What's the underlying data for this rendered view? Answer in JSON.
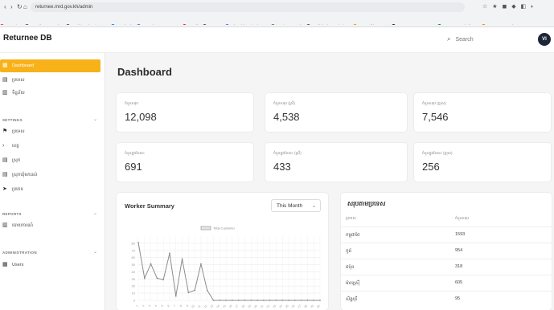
{
  "browser": {
    "url": "returnee.mrd.gov.kh/admin",
    "nav_glyphs": [
      "‹",
      "›",
      "↻",
      "⌂"
    ],
    "ext_icons": "☆ ★ ◼ ◆ ◧ ◐",
    "bookmarks": [
      {
        "label": "YouTube",
        "color": "#e53935"
      },
      {
        "label": "Contributor Portal -",
        "color": "#555555"
      },
      {
        "label": "Dashboard - Micros...",
        "color": "#555555"
      },
      {
        "label": "Facebook",
        "color": "#1877f2"
      },
      {
        "label": "YouTube to mp3 Co...",
        "color": "#5b6bd6"
      },
      {
        "label": "Gmail",
        "color": "#d93025"
      },
      {
        "label": "WHOIS",
        "color": "#555555"
      },
      {
        "label": "Inbox (1) - sokrolurn...",
        "color": "#5b6bd6"
      },
      {
        "label": "Bot (ECTT Bot)",
        "color": "#4a8f3a"
      },
      {
        "label": "English Khmer Dictio...",
        "color": "#555555"
      },
      {
        "label": "Accessible - Cost",
        "color": "#e0a000"
      },
      {
        "label": "IT CAREER JOBS&...",
        "color": "#1d2638"
      },
      {
        "label": "Convert Excel Files...",
        "color": "#1e7e34"
      },
      {
        "label": "OCR PDF Word Fr...",
        "color": "#e67e22"
      }
    ]
  },
  "app": {
    "title": "Returnee DB",
    "search_icon": "⌕",
    "search_placeholder": "Search",
    "avatar_initials": "VI"
  },
  "sidebar": {
    "items": [
      {
        "label": "Dashboard",
        "icon": "grid-icon",
        "glyph": "▦"
      },
      {
        "label": "ប្រទេស",
        "icon": "list-icon",
        "glyph": "▤"
      },
      {
        "label": "ទិន្នន័យ",
        "icon": "file-icon",
        "glyph": "▥"
      }
    ],
    "sections": [
      {
        "heading": "SETTINGS",
        "items": [
          {
            "label": "ប្រទេស",
            "icon": "flag-icon",
            "glyph": "⚑"
          },
          {
            "label": "ខេត្ត",
            "icon": "arrow-icon",
            "glyph": "›"
          },
          {
            "label": "ស្រុក",
            "icon": "doc-icon",
            "glyph": "▤"
          },
          {
            "label": "ស្រុកឃុំមកដល់",
            "icon": "doc-icon",
            "glyph": "▤"
          },
          {
            "label": "ប្រភេទ",
            "icon": "arrow-icon",
            "glyph": "➤"
          }
        ]
      },
      {
        "heading": "REPORTS",
        "items": [
          {
            "label": "របាយការណ៍",
            "icon": "report-icon",
            "glyph": "▥"
          }
        ]
      },
      {
        "heading": "ADMINISTRATION",
        "items": [
          {
            "label": "Users",
            "icon": "users-icon",
            "glyph": "▦"
          }
        ]
      }
    ]
  },
  "main": {
    "page_title": "Dashboard",
    "stats": [
      {
        "label": "ចំនួនសរុប",
        "value": "12,098"
      },
      {
        "label": "ចំនួនសរុប (ស្រី)",
        "value": "4,538"
      },
      {
        "label": "ចំនួនសរុប (ប្រុស)",
        "value": "7,546"
      },
      {
        "label": "ចំនួនក្នុងខែនេះ",
        "value": "691"
      },
      {
        "label": "ចំនួនក្នុងខែនេះ (ស្រី)",
        "value": "433"
      },
      {
        "label": "ចំនួនក្នុងខែនេះ (ប្រុស)",
        "value": "256"
      }
    ],
    "chart_panel": {
      "title": "Worker Summary",
      "dropdown_value": "This Month",
      "dropdown_chevron": "⌄"
    },
    "table_panel": {
      "title": "សរុបតាមប្រទេស",
      "headers": [
        "ប្រទេស",
        "ចំនួនសរុប"
      ],
      "rows": [
        {
          "country": "កម្ពុជាថៃ",
          "count": "1593"
        },
        {
          "country": "កូរ៉េ",
          "count": "954"
        },
        {
          "country": "ជប៉ុន",
          "count": "318"
        },
        {
          "country": "ម៉ាឡេស៊ី",
          "count": "605"
        },
        {
          "country": "សិង្ហបុរី",
          "count": "95"
        }
      ]
    }
  },
  "chart_data": {
    "type": "line",
    "title": "",
    "legend": [
      "Total Customer"
    ],
    "legend_position": "top-center",
    "grid": true,
    "ylim": [
      0,
      90
    ],
    "yticks": [
      0,
      10,
      20,
      30,
      40,
      50,
      60,
      70,
      80
    ],
    "x": [
      "1",
      "2",
      "3",
      "4",
      "5",
      "6",
      "7",
      "8",
      "9",
      "10",
      "11",
      "12",
      "13",
      "14",
      "15",
      "16",
      "17",
      "18",
      "19",
      "20",
      "21",
      "22",
      "23",
      "24",
      "25",
      "26",
      "27",
      "28",
      "29",
      "30"
    ],
    "series": [
      {
        "name": "Total Customer",
        "color": "#8c8c8c",
        "values": [
          81,
          31,
          51,
          31,
          29,
          66,
          6,
          58,
          11,
          14,
          51,
          14,
          0,
          0,
          0,
          0,
          0,
          0,
          0,
          0,
          0,
          0,
          0,
          0,
          0,
          0,
          0,
          0,
          0,
          0
        ]
      }
    ]
  }
}
